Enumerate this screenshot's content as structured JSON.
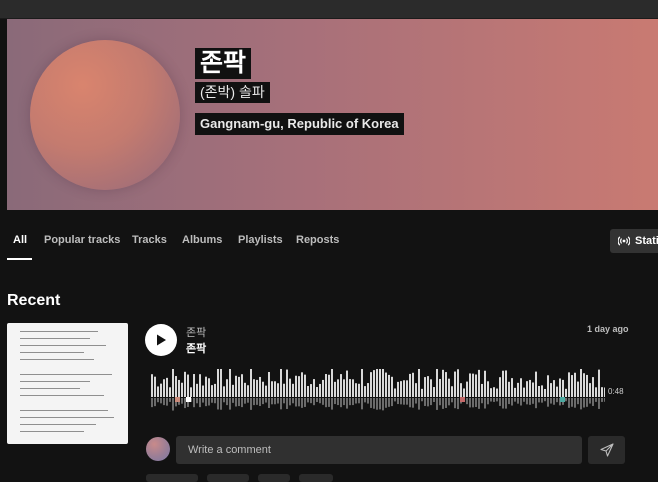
{
  "profile": {
    "name": "존팍",
    "subtitle": "(존박) 솔파",
    "location": "Gangnam-gu, Republic of Korea"
  },
  "tabs": [
    {
      "label": "All",
      "active": true
    },
    {
      "label": "Popular tracks",
      "active": false
    },
    {
      "label": "Tracks",
      "active": false
    },
    {
      "label": "Albums",
      "active": false
    },
    {
      "label": "Playlists",
      "active": false
    },
    {
      "label": "Reposts",
      "active": false
    }
  ],
  "station_button": {
    "label": "Stati",
    "icon": "station-icon"
  },
  "recent": {
    "title": "Recent",
    "track": {
      "artist": "존팍",
      "title": "존팍",
      "posted": "1 day ago",
      "duration": "0:48",
      "play_icon": "play-icon"
    }
  },
  "comment": {
    "placeholder": "Write a comment",
    "send_icon": "send-icon"
  },
  "colors": {
    "background": "#121212",
    "hero_start": "#8a6a79",
    "hero_end": "#c97a72",
    "text_secondary": "#bdbdbd"
  }
}
